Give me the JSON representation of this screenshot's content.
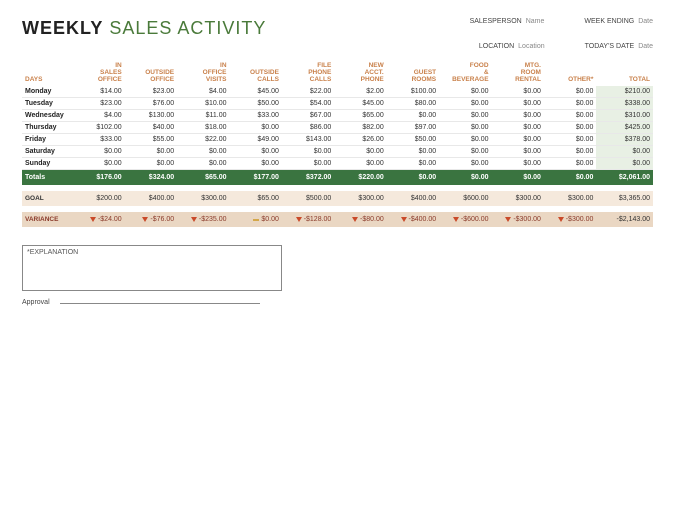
{
  "title": {
    "bold": "WEEKLY",
    "light": "SALES ACTIVITY"
  },
  "meta": {
    "salesperson_label": "SALESPERSON",
    "salesperson_value": "Name",
    "location_label": "LOCATION",
    "location_value": "Location",
    "weekending_label": "WEEK ENDING",
    "weekending_value": "Date",
    "todaysdate_label": "TODAY'S DATE",
    "todaysdate_value": "Date"
  },
  "headers": [
    "DAYS",
    "IN SALES OFFICE",
    "OUTSIDE OFFICE",
    "IN OFFICE VISITS",
    "OUTSIDE CALLS",
    "FILE PHONE CALLS",
    "NEW ACCT. PHONE",
    "GUEST ROOMS",
    "FOOD & BEVERAGE",
    "MTG. ROOM RENTAL",
    "OTHER*",
    "TOTAL"
  ],
  "rows": [
    {
      "day": "Monday",
      "v": [
        "$14.00",
        "$23.00",
        "$4.00",
        "$45.00",
        "$22.00",
        "$2.00",
        "$100.00",
        "$0.00",
        "$0.00",
        "$0.00",
        "$210.00"
      ]
    },
    {
      "day": "Tuesday",
      "v": [
        "$23.00",
        "$76.00",
        "$10.00",
        "$50.00",
        "$54.00",
        "$45.00",
        "$80.00",
        "$0.00",
        "$0.00",
        "$0.00",
        "$338.00"
      ]
    },
    {
      "day": "Wednesday",
      "v": [
        "$4.00",
        "$130.00",
        "$11.00",
        "$33.00",
        "$67.00",
        "$65.00",
        "$0.00",
        "$0.00",
        "$0.00",
        "$0.00",
        "$310.00"
      ]
    },
    {
      "day": "Thursday",
      "v": [
        "$102.00",
        "$40.00",
        "$18.00",
        "$0.00",
        "$86.00",
        "$82.00",
        "$97.00",
        "$0.00",
        "$0.00",
        "$0.00",
        "$425.00"
      ]
    },
    {
      "day": "Friday",
      "v": [
        "$33.00",
        "$55.00",
        "$22.00",
        "$49.00",
        "$143.00",
        "$26.00",
        "$50.00",
        "$0.00",
        "$0.00",
        "$0.00",
        "$378.00"
      ]
    },
    {
      "day": "Saturday",
      "v": [
        "$0.00",
        "$0.00",
        "$0.00",
        "$0.00",
        "$0.00",
        "$0.00",
        "$0.00",
        "$0.00",
        "$0.00",
        "$0.00",
        "$0.00"
      ]
    },
    {
      "day": "Sunday",
      "v": [
        "$0.00",
        "$0.00",
        "$0.00",
        "$0.00",
        "$0.00",
        "$0.00",
        "$0.00",
        "$0.00",
        "$0.00",
        "$0.00",
        "$0.00"
      ]
    }
  ],
  "totals": {
    "label": "Totals",
    "v": [
      "$176.00",
      "$324.00",
      "$65.00",
      "$177.00",
      "$372.00",
      "$220.00",
      "$0.00",
      "$0.00",
      "$0.00",
      "$0.00",
      "$2,061.00"
    ]
  },
  "goal": {
    "label": "GOAL",
    "v": [
      "$200.00",
      "$400.00",
      "$300.00",
      "$65.00",
      "$500.00",
      "$300.00",
      "$400.00",
      "$600.00",
      "$300.00",
      "$300.00",
      "$3,365.00"
    ]
  },
  "variance": {
    "label": "VARIANCE",
    "v": [
      {
        "ind": "down",
        "val": "-$24.00"
      },
      {
        "ind": "down",
        "val": "-$76.00"
      },
      {
        "ind": "down",
        "val": "-$235.00"
      },
      {
        "ind": "flat",
        "val": "$0.00"
      },
      {
        "ind": "down",
        "val": "-$128.00"
      },
      {
        "ind": "down",
        "val": "-$80.00"
      },
      {
        "ind": "down",
        "val": "-$400.00"
      },
      {
        "ind": "down",
        "val": "-$600.00"
      },
      {
        "ind": "down",
        "val": "-$300.00"
      },
      {
        "ind": "down",
        "val": "-$300.00"
      },
      {
        "ind": "",
        "val": "-$2,143.00"
      }
    ]
  },
  "explain_label": "*EXPLANATION",
  "approval_label": "Approval",
  "chart_data": {
    "type": "table",
    "title": "Weekly Sales Activity",
    "columns": [
      "DAYS",
      "IN SALES OFFICE",
      "OUTSIDE OFFICE",
      "IN OFFICE VISITS",
      "OUTSIDE CALLS",
      "FILE PHONE CALLS",
      "NEW ACCT. PHONE",
      "GUEST ROOMS",
      "FOOD & BEVERAGE",
      "MTG. ROOM RENTAL",
      "OTHER*",
      "TOTAL"
    ],
    "data": [
      [
        "Monday",
        14,
        23,
        4,
        45,
        22,
        2,
        100,
        0,
        0,
        0,
        210
      ],
      [
        "Tuesday",
        23,
        76,
        10,
        50,
        54,
        45,
        80,
        0,
        0,
        0,
        338
      ],
      [
        "Wednesday",
        4,
        130,
        11,
        33,
        67,
        65,
        0,
        0,
        0,
        0,
        310
      ],
      [
        "Thursday",
        102,
        40,
        18,
        0,
        86,
        82,
        97,
        0,
        0,
        0,
        425
      ],
      [
        "Friday",
        33,
        55,
        22,
        49,
        143,
        26,
        50,
        0,
        0,
        0,
        378
      ],
      [
        "Saturday",
        0,
        0,
        0,
        0,
        0,
        0,
        0,
        0,
        0,
        0,
        0
      ],
      [
        "Sunday",
        0,
        0,
        0,
        0,
        0,
        0,
        0,
        0,
        0,
        0,
        0
      ],
      [
        "Totals",
        176,
        324,
        65,
        177,
        372,
        220,
        0,
        0,
        0,
        0,
        2061
      ],
      [
        "GOAL",
        200,
        400,
        300,
        65,
        500,
        300,
        400,
        600,
        300,
        300,
        3365
      ],
      [
        "VARIANCE",
        -24,
        -76,
        -235,
        0,
        -128,
        -80,
        -400,
        -600,
        -300,
        -300,
        -2143
      ]
    ]
  }
}
